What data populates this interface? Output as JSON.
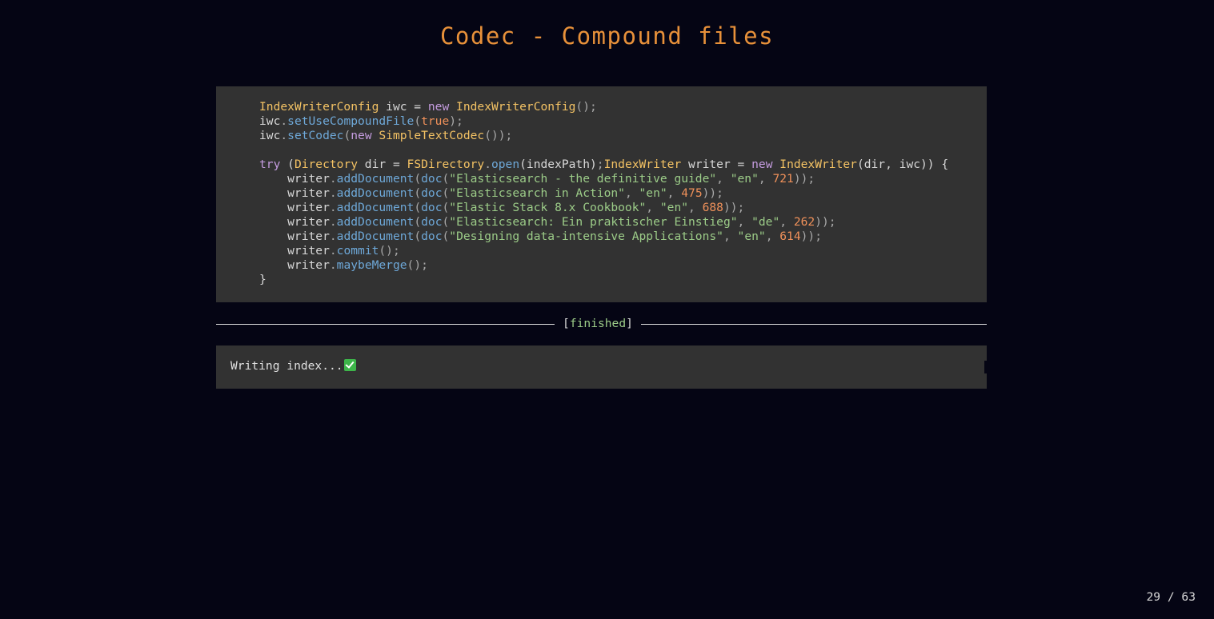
{
  "slide": {
    "title": "Codec - Compound files",
    "page_indicator": "29 / 63"
  },
  "code": {
    "lines": [
      [
        [
          "type",
          "IndexWriterConfig"
        ],
        [
          "plain",
          " iwc = "
        ],
        [
          "kw",
          "new"
        ],
        [
          "plain",
          " "
        ],
        [
          "type",
          "IndexWriterConfig"
        ],
        [
          "punc",
          "();"
        ]
      ],
      [
        [
          "plain",
          "iwc"
        ],
        [
          "punc",
          "."
        ],
        [
          "fn",
          "setUseCompoundFile"
        ],
        [
          "punc",
          "("
        ],
        [
          "bool",
          "true"
        ],
        [
          "punc",
          ");"
        ]
      ],
      [
        [
          "plain",
          "iwc"
        ],
        [
          "punc",
          "."
        ],
        [
          "fn",
          "setCodec"
        ],
        [
          "punc",
          "("
        ],
        [
          "kw",
          "new"
        ],
        [
          "plain",
          " "
        ],
        [
          "type",
          "SimpleTextCodec"
        ],
        [
          "punc",
          "());"
        ]
      ],
      [],
      [
        [
          "kw",
          "try"
        ],
        [
          "plain",
          " ("
        ],
        [
          "type",
          "Directory"
        ],
        [
          "plain",
          " dir = "
        ],
        [
          "type",
          "FSDirectory"
        ],
        [
          "punc",
          "."
        ],
        [
          "fn",
          "open"
        ],
        [
          "plain",
          "(indexPath)"
        ],
        [
          "punc",
          ";"
        ],
        [
          "type",
          "IndexWriter"
        ],
        [
          "plain",
          " writer = "
        ],
        [
          "kw",
          "new"
        ],
        [
          "plain",
          " "
        ],
        [
          "type",
          "IndexWriter"
        ],
        [
          "plain",
          "(dir, iwc)) {"
        ]
      ],
      [
        [
          "plain",
          "    writer"
        ],
        [
          "punc",
          "."
        ],
        [
          "fn",
          "addDocument"
        ],
        [
          "punc",
          "("
        ],
        [
          "fn",
          "doc"
        ],
        [
          "punc",
          "("
        ],
        [
          "str",
          "\"Elasticsearch - the definitive guide\""
        ],
        [
          "punc",
          ", "
        ],
        [
          "str",
          "\"en\""
        ],
        [
          "punc",
          ", "
        ],
        [
          "num",
          "721"
        ],
        [
          "punc",
          "));"
        ]
      ],
      [
        [
          "plain",
          "    writer"
        ],
        [
          "punc",
          "."
        ],
        [
          "fn",
          "addDocument"
        ],
        [
          "punc",
          "("
        ],
        [
          "fn",
          "doc"
        ],
        [
          "punc",
          "("
        ],
        [
          "str",
          "\"Elasticsearch in Action\""
        ],
        [
          "punc",
          ", "
        ],
        [
          "str",
          "\"en\""
        ],
        [
          "punc",
          ", "
        ],
        [
          "num",
          "475"
        ],
        [
          "punc",
          "));"
        ]
      ],
      [
        [
          "plain",
          "    writer"
        ],
        [
          "punc",
          "."
        ],
        [
          "fn",
          "addDocument"
        ],
        [
          "punc",
          "("
        ],
        [
          "fn",
          "doc"
        ],
        [
          "punc",
          "("
        ],
        [
          "str",
          "\"Elastic Stack 8.x Cookbook\""
        ],
        [
          "punc",
          ", "
        ],
        [
          "str",
          "\"en\""
        ],
        [
          "punc",
          ", "
        ],
        [
          "num",
          "688"
        ],
        [
          "punc",
          "));"
        ]
      ],
      [
        [
          "plain",
          "    writer"
        ],
        [
          "punc",
          "."
        ],
        [
          "fn",
          "addDocument"
        ],
        [
          "punc",
          "("
        ],
        [
          "fn",
          "doc"
        ],
        [
          "punc",
          "("
        ],
        [
          "str",
          "\"Elasticsearch: Ein praktischer Einstieg\""
        ],
        [
          "punc",
          ", "
        ],
        [
          "str",
          "\"de\""
        ],
        [
          "punc",
          ", "
        ],
        [
          "num",
          "262"
        ],
        [
          "punc",
          "));"
        ]
      ],
      [
        [
          "plain",
          "    writer"
        ],
        [
          "punc",
          "."
        ],
        [
          "fn",
          "addDocument"
        ],
        [
          "punc",
          "("
        ],
        [
          "fn",
          "doc"
        ],
        [
          "punc",
          "("
        ],
        [
          "str",
          "\"Designing data-intensive Applications\""
        ],
        [
          "punc",
          ", "
        ],
        [
          "str",
          "\"en\""
        ],
        [
          "punc",
          ", "
        ],
        [
          "num",
          "614"
        ],
        [
          "punc",
          "));"
        ]
      ],
      [
        [
          "plain",
          "    writer"
        ],
        [
          "punc",
          "."
        ],
        [
          "fn",
          "commit"
        ],
        [
          "punc",
          "();"
        ]
      ],
      [
        [
          "plain",
          "    writer"
        ],
        [
          "punc",
          "."
        ],
        [
          "fn",
          "maybeMerge"
        ],
        [
          "punc",
          "();"
        ]
      ],
      [
        [
          "plain",
          "}"
        ]
      ]
    ]
  },
  "run": {
    "bracket_open": "[",
    "status": "finished",
    "bracket_close": "]"
  },
  "output": {
    "text": "Writing index...",
    "icon": "check-mark-icon",
    "icon_color": "#3db54a"
  },
  "colors": {
    "background": "#050514",
    "title": "#e8913a",
    "code_background": "#323232",
    "type": "#f3c264",
    "keyword": "#c59ce0",
    "function": "#6ea8d8",
    "string": "#9ccc88",
    "number": "#f0915a"
  }
}
